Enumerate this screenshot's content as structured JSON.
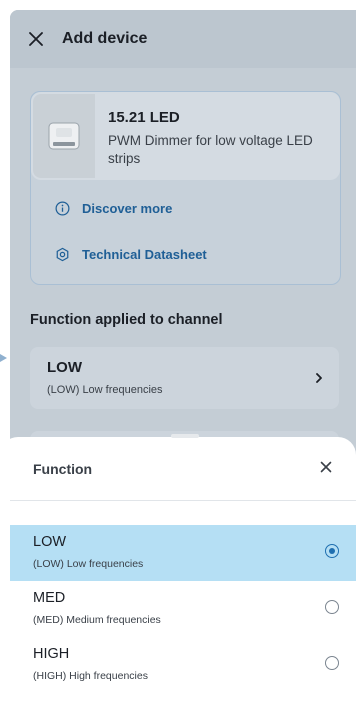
{
  "header": {
    "title": "Add device",
    "close_icon": "close-icon"
  },
  "device": {
    "name": "15.21 LED",
    "description": "PWM Dimmer for low voltage LED strips",
    "image_icon": "device-module-icon"
  },
  "links": [
    {
      "label": "Discover more",
      "icon": "info-icon"
    },
    {
      "label": "Technical Datasheet",
      "icon": "datasheet-icon"
    }
  ],
  "section": {
    "title": "Function applied to channel"
  },
  "channel": {
    "value": "LOW",
    "subtitle": "(LOW) Low frequencies",
    "chevron_icon": "chevron-right-icon"
  },
  "sheet": {
    "title": "Function",
    "close_icon": "close-icon",
    "options": [
      {
        "label": "LOW",
        "subtitle": "(LOW) Low frequencies",
        "selected": true
      },
      {
        "label": "MED",
        "subtitle": "(MED) Medium frequencies",
        "selected": false
      },
      {
        "label": "HIGH",
        "subtitle": "(HIGH) High frequencies",
        "selected": false
      }
    ]
  },
  "colors": {
    "accent": "#1f6fb0",
    "link": "#1f5f96",
    "selected_bg": "#b5dff4",
    "overlay": "#c4cdd5"
  }
}
